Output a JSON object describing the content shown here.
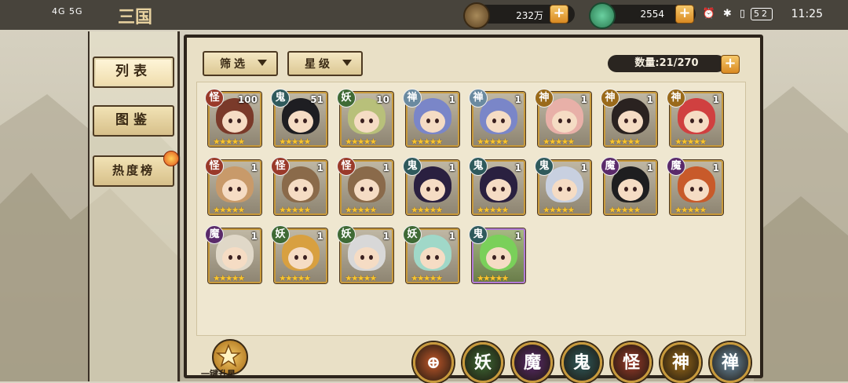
{
  "status_bar": {
    "left": "4G 5G",
    "time": "11:25",
    "battery": "52",
    "logo": "三国"
  },
  "resources": [
    {
      "name": "copper",
      "value": "232万",
      "icon": "coin-icon",
      "color": "#8a6a3a"
    },
    {
      "name": "jade",
      "value": "2554",
      "icon": "jade-icon",
      "color": "#3aa070"
    }
  ],
  "sidebar": {
    "items": [
      {
        "label": "列表",
        "active": true
      },
      {
        "label": "图鉴",
        "active": false
      },
      {
        "label": "热度榜",
        "active": false
      }
    ]
  },
  "filters": {
    "filter_label": "筛选",
    "star_label": "星级"
  },
  "count": {
    "label": "数量:21/270"
  },
  "factions": {
    "怪": "#9a3a2a",
    "鬼": "#2f5a5c",
    "妖": "#3f6a35",
    "禅": "#6a8aa0",
    "神": "#9a6a1a",
    "魔": "#5a2a6a"
  },
  "heroes": [
    {
      "faction": "怪",
      "level": "100",
      "stars": 5,
      "hair": "#7a3a2a"
    },
    {
      "faction": "鬼",
      "level": "51",
      "stars": 5,
      "hair": "#1e1e22"
    },
    {
      "faction": "妖",
      "level": "10",
      "stars": 5,
      "hair": "#b8c07a"
    },
    {
      "faction": "禅",
      "level": "1",
      "stars": 5,
      "hair": "#7a86c8"
    },
    {
      "faction": "禅",
      "level": "1",
      "stars": 5,
      "hair": "#7a86c8"
    },
    {
      "faction": "神",
      "level": "1",
      "stars": 5,
      "hair": "#e8b0a8"
    },
    {
      "faction": "神",
      "level": "1",
      "stars": 5,
      "hair": "#2a2220"
    },
    {
      "faction": "神",
      "level": "1",
      "stars": 5,
      "hair": "#d04040"
    },
    {
      "faction": "怪",
      "level": "1",
      "stars": 5,
      "hair": "#c89a6a"
    },
    {
      "faction": "怪",
      "level": "1",
      "stars": 5,
      "hair": "#8a6a4a"
    },
    {
      "faction": "怪",
      "level": "1",
      "stars": 5,
      "hair": "#8a6a4a"
    },
    {
      "faction": "鬼",
      "level": "1",
      "stars": 5,
      "hair": "#2a2040"
    },
    {
      "faction": "鬼",
      "level": "1",
      "stars": 5,
      "hair": "#2a2040"
    },
    {
      "faction": "鬼",
      "level": "1",
      "stars": 5,
      "hair": "#c8d0e0"
    },
    {
      "faction": "魔",
      "level": "1",
      "stars": 5,
      "hair": "#1e1e20"
    },
    {
      "faction": "魔",
      "level": "1",
      "stars": 5,
      "hair": "#c85a2a"
    },
    {
      "faction": "魔",
      "level": "1",
      "stars": 5,
      "hair": "#e0d8c8"
    },
    {
      "faction": "妖",
      "level": "1",
      "stars": 5,
      "hair": "#d8a040"
    },
    {
      "faction": "妖",
      "level": "1",
      "stars": 5,
      "hair": "#d8d8d8"
    },
    {
      "faction": "妖",
      "level": "1",
      "stars": 5,
      "hair": "#a0d8c8"
    },
    {
      "faction": "鬼",
      "level": "1",
      "stars": 5,
      "hair": "#7ad05a",
      "rare": true
    }
  ],
  "bottom_bar": {
    "upstar_label": "一键升星",
    "faction_buttons": [
      {
        "label": "",
        "icon": "all-factions-icon",
        "color": "#c0582a"
      },
      {
        "label": "妖",
        "color": "#3f6a35"
      },
      {
        "label": "魔",
        "color": "#5a2a6a"
      },
      {
        "label": "鬼",
        "color": "#2f5a5c"
      },
      {
        "label": "怪",
        "color": "#9a3a2a"
      },
      {
        "label": "神",
        "color": "#9a6a1a"
      },
      {
        "label": "禅",
        "color": "#6a8aa0"
      }
    ]
  }
}
